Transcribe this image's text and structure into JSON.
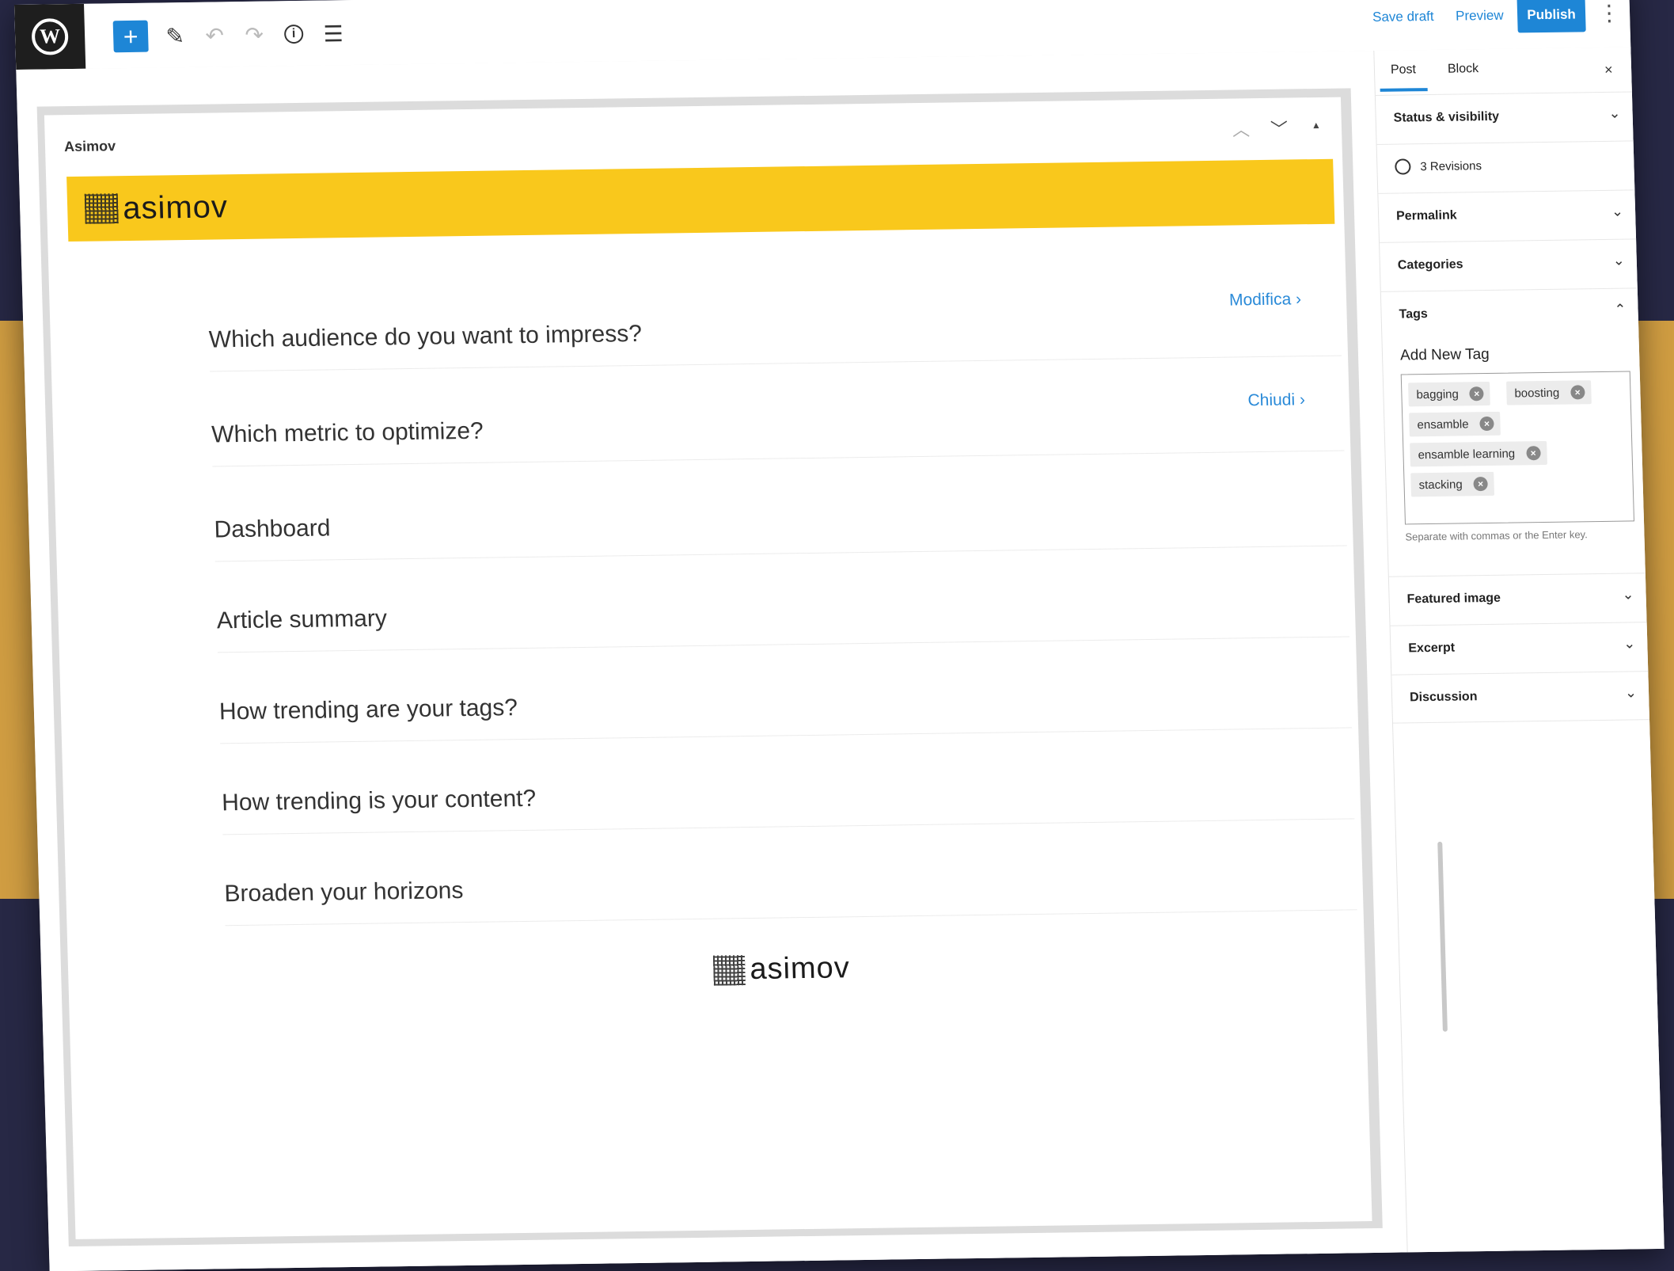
{
  "toolbar": {
    "save_draft": "Save draft",
    "preview": "Preview",
    "publish": "Publish"
  },
  "block": {
    "title": "Asimov",
    "banner_logo": "asimov",
    "footer_logo": "asimov"
  },
  "links": {
    "modifica": "Modifica ›",
    "chiudi": "Chiudi ›"
  },
  "sections": [
    "Which audience do you want to impress?",
    "Which metric to optimize?",
    "Dashboard",
    "Article summary",
    "How trending are your tags?",
    "How trending is your content?",
    "Broaden your horizons"
  ],
  "sidebar": {
    "tabs": [
      "Post",
      "Block"
    ],
    "close": "×",
    "status": "Status & visibility",
    "revisions": "3 Revisions",
    "permalink": "Permalink",
    "categories": "Categories",
    "tags": "Tags",
    "add_new_tag": "Add New Tag",
    "tag_chips": [
      "bagging",
      "boosting",
      "ensamble",
      "ensamble learning",
      "stacking"
    ],
    "tag_hint": "Separate with commas or the Enter key.",
    "featured_image": "Featured image",
    "excerpt": "Excerpt",
    "discussion": "Discussion"
  },
  "colors": {
    "accent": "#1e86d6",
    "banner": "#f9c81c",
    "background": "#272845",
    "band": "#d09d42"
  }
}
